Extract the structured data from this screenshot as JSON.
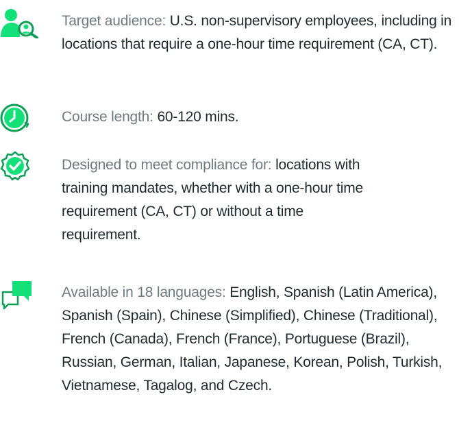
{
  "colors": {
    "accent": "#14e07a",
    "accent_dark": "#0b9f55",
    "label": "#6f7a80",
    "value": "#1f2a2e"
  },
  "items": [
    {
      "icon": "person-search-icon",
      "label": "Target audience:",
      "value": "U.S. non-supervisory employees, including in locations that require a one-hour time requirement (CA, CT)."
    },
    {
      "icon": "clock-icon",
      "label": "Course length:",
      "value": "60-120 mins."
    },
    {
      "icon": "check-badge-icon",
      "label": "Designed to meet compliance for:",
      "value": "locations with training mandates, whether with a one-hour time requirement (CA, CT) or without a time requirement."
    },
    {
      "icon": "chat-bubbles-icon",
      "label": "Available in 18 languages:",
      "value": "English, Spanish (Latin America), Spanish (Spain), Chinese (Simplified), Chinese (Traditional), French (Canada), French (France), Portuguese (Brazil), Russian, German, Italian, Japanese, Korean, Polish, Turkish, Vietnamese, Tagalog, and Czech."
    }
  ]
}
